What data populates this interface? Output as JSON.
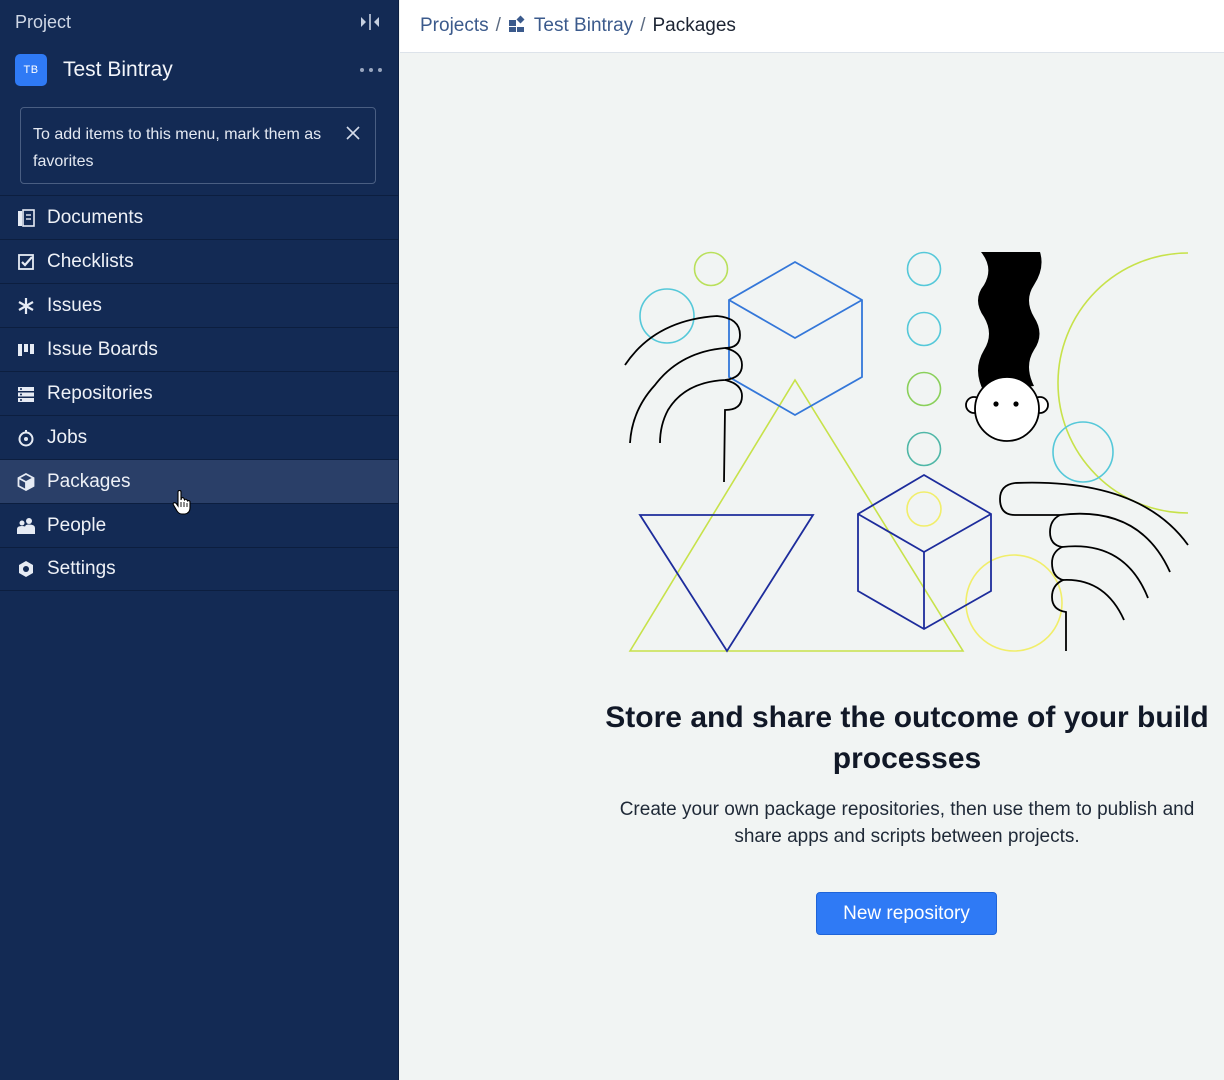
{
  "sidebar": {
    "header_title": "Project",
    "project": {
      "avatar_initials": "TB",
      "name": "Test Bintray"
    },
    "favorites_hint": "To add items to this menu, mark them as favorites",
    "items": [
      {
        "label": "Documents",
        "icon": "documents-icon"
      },
      {
        "label": "Checklists",
        "icon": "checklist-icon"
      },
      {
        "label": "Issues",
        "icon": "issues-asterisk-icon"
      },
      {
        "label": "Issue Boards",
        "icon": "issue-boards-icon"
      },
      {
        "label": "Repositories",
        "icon": "repositories-icon"
      },
      {
        "label": "Jobs",
        "icon": "jobs-icon"
      },
      {
        "label": "Packages",
        "icon": "packages-icon",
        "active": true
      },
      {
        "label": "People",
        "icon": "people-icon"
      },
      {
        "label": "Settings",
        "icon": "settings-icon"
      }
    ]
  },
  "breadcrumb": {
    "root": "Projects",
    "project": "Test Bintray",
    "current": "Packages",
    "separator": "/"
  },
  "empty_state": {
    "headline": "Store and share the outcome of your build processes",
    "description": "Create your own package repositories, then use them to publish and share apps and scripts between projects.",
    "button_label": "New repository"
  },
  "colors": {
    "sidebar_bg": "#132a54",
    "sidebar_active": "#2a3f68",
    "accent": "#2f7af5",
    "main_bg": "#f1f4f3"
  }
}
